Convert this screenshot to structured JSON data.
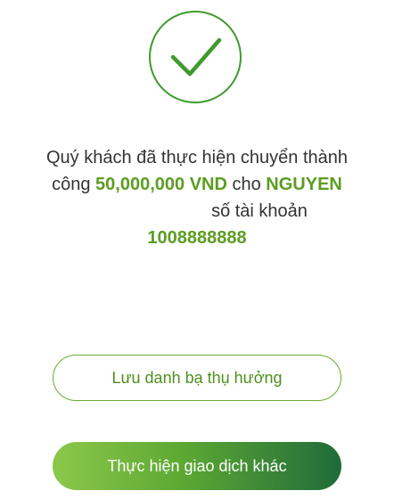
{
  "success_icon": "check-circle-icon",
  "message": {
    "line1": "Quý khách đã thực hiện chuyển thành",
    "line2_prefix": "công ",
    "amount": "50,000,000 VND",
    "line2_middle": " cho ",
    "recipient_name": "NGUYEN",
    "account_label": "số tài khoản",
    "account_number": "1008888888"
  },
  "buttons": {
    "save_contact": "Lưu danh bạ thụ hưởng",
    "new_transaction": "Thực hiện giao dịch khác"
  },
  "colors": {
    "accent_green": "#5c9d22",
    "button_gradient_start": "#8cc84b",
    "button_gradient_end": "#1f6b3a"
  }
}
